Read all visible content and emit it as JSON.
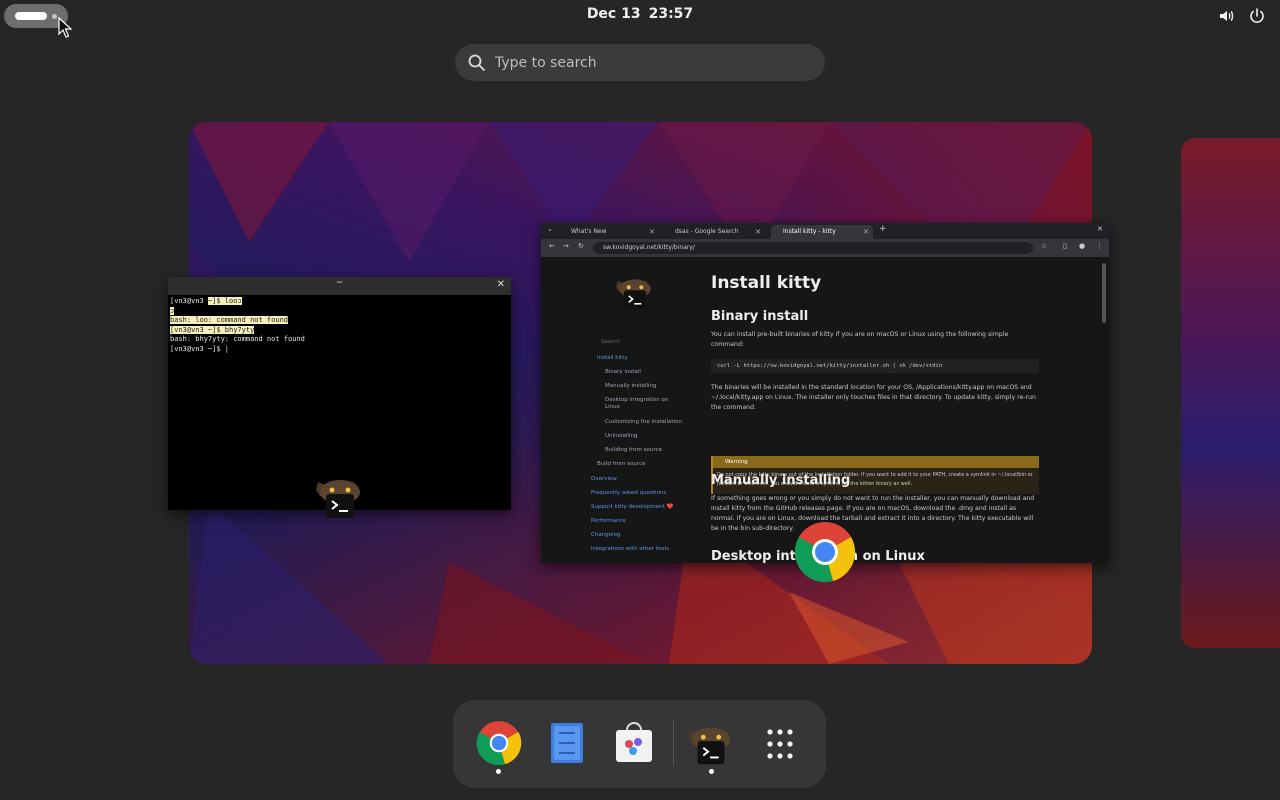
{
  "topbar": {
    "date": "Dec 13",
    "time": "23:57"
  },
  "search": {
    "placeholder": "Type to search"
  },
  "terminal": {
    "title": "~",
    "lines": [
      {
        "text": "[vn3@vn3 ~]$ looɔ",
        "hl": "~]$ looɔ"
      },
      {
        "text": "ɔ",
        "hl": "ɔ"
      },
      {
        "text": "bash: loo: command not found",
        "hl": "bash: loo: command not found"
      },
      {
        "text": "[vn3@vn3 ~]$ bhy7yty",
        "hl": "[vn3@vn3 ~]$ bhy7yty"
      },
      {
        "text": "bash: bhy7yty: command not found",
        "hl": ""
      },
      {
        "text": "[vn3@vn3 ~]$ |",
        "hl": ""
      }
    ]
  },
  "browser": {
    "tabs": [
      "What's New",
      "dsas - Google Search",
      "Install kitty - kitty"
    ],
    "url": "sw.kovidgoyal.net/kitty/binary/",
    "sidebar": {
      "search": "Search",
      "items": [
        "Install kitty",
        "Binary install",
        "Manually installing",
        "Desktop integration on",
        "Linux",
        "Customizing the installation",
        "Uninstalling",
        "Building from source",
        "Build from source",
        "Overview",
        "Frequently asked questions",
        "Support kitty development ❤️",
        "Performance",
        "Changelog",
        "Integrations with other tools"
      ]
    },
    "content": {
      "title": "Install kitty",
      "h_binary": "Binary install",
      "p_binary": "You can install pre-built binaries of kitty if you are on macOS or Linux using the following simple command:",
      "code": "curl -L https://sw.kovidgoyal.net/kitty/installer.sh | sh /dev/stdin",
      "p_location": "The binaries will be installed in the standard location for your OS, /Applications/kitty.app on macOS and ~/.local/kitty.app on Linux. The installer only touches files in that directory. To update kitty, simply re-run the command.",
      "warning_label": "Warning",
      "warning_text": "Do not copy the kitty binary out of the installation folder. If you want to add it to your PATH, create a symlink in ~/.local/bin or /usr/bin or wherever. You should create a symlink for the kitten binary as well.",
      "h_manual": "Manually installing",
      "p_manual": "If something goes wrong or you simply do not want to run the installer, you can manually download and install kitty from the GitHub releases page. If you are on macOS, download the .dmg and install as normal. If you are on Linux, download the tarball and extract it into a directory. The kitty executable will be in the bin sub-directory.",
      "h_desktop": "Desktop integration on Linux"
    }
  },
  "dock": {
    "items": [
      "Google Chrome",
      "Text Editor",
      "Software",
      "kitty",
      "Show Apps"
    ]
  },
  "colors": {
    "accent_link": "#5a98e0",
    "warning": "#8a6a1c",
    "highlight": "#f5efb9"
  }
}
